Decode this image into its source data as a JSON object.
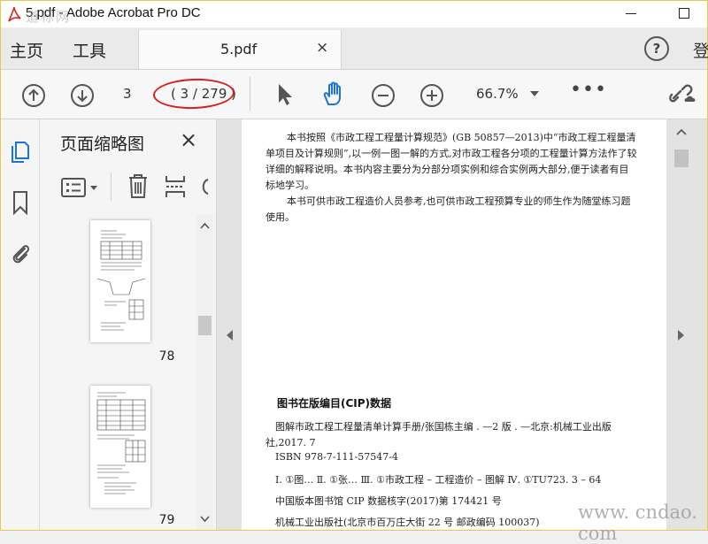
{
  "window": {
    "title": "5.pdf - Adobe Acrobat Pro DC",
    "watermark_top": "道标网"
  },
  "menu": {
    "home": "主页",
    "tools": "工具"
  },
  "tab": {
    "name": "5.pdf",
    "close": "×"
  },
  "header_right": {
    "help": "?",
    "cut_text": "登"
  },
  "toolbar": {
    "page_current": "3",
    "page_count": "( 3 / 279 )",
    "zoom": "66.7%",
    "more": "•••"
  },
  "panel": {
    "title": "页面缩略图",
    "close": "×",
    "thumbnails": [
      {
        "page": "78"
      },
      {
        "page": "79"
      }
    ]
  },
  "document": {
    "paragraph1": "本书按照《市政工程工程量计算规范》(GB 50857—2013)中“市政工程工程量清单项目及计算规则”,以一例一图一解的方式,对市政工程各分项的工程量计算方法作了较详细的解释说明。本书内容主要分为分部分项实例和综合实例两大部分,便于读者有目标地学习。",
    "paragraph2": "本书可供市政工程造价人员参考,也可供市政工程预算专业的师生作为随堂练习题使用。",
    "cip_title": "图书在版编目(CIP)数据",
    "cip_line1": "图解市政工程工程量清单计算手册/张国栋主编 . —2 版 . —北京:机械工业出版",
    "cip_line2": "社,2017. 7",
    "isbn": "ISBN 978-7-111-57547-4",
    "classification": "Ⅰ. ①图…   Ⅱ. ①张…   Ⅲ. ①市政工程 – 工程造价 – 图解   Ⅳ. ①TU723. 3 – 64",
    "cip_record": "中国版本图书馆 CIP 数据核字(2017)第 174421 号",
    "publisher": "机械工业出版社(北京市百万庄大街 22 号   邮政编码 100037)"
  },
  "watermark_bottom": "www. cndao. com",
  "colors": {
    "highlight_ellipse": "#d42222",
    "icon_blue": "#1a73d9",
    "window_border": "#e7c94b"
  }
}
